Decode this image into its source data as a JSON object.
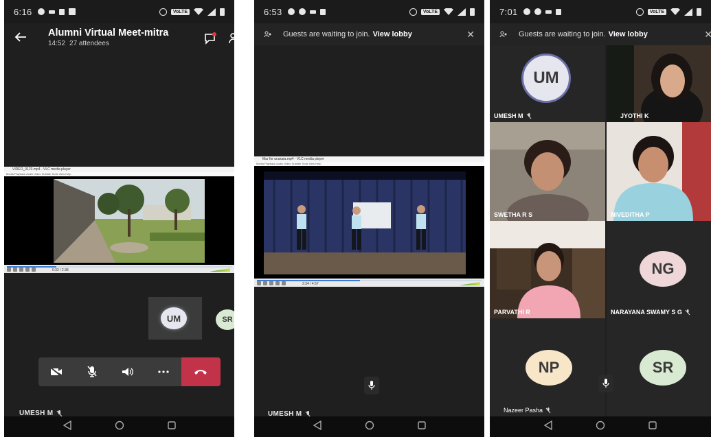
{
  "screens": [
    {
      "status": {
        "time": "6:16",
        "volte": "VoLTE"
      },
      "header": {
        "title": "Alumni Virtual Meet-mitra",
        "duration": "14:52",
        "attendees": "27 attendees"
      },
      "vlc": {
        "title": "VIDEO_0123.mp4 - VLC media player",
        "menu": "Media  Playback  Audio  Video  Subtitle  Tools  View  Help",
        "time": "0:32 / 2:38"
      },
      "avatars": [
        {
          "initials": "UM",
          "color": "#e6e6ee"
        },
        {
          "initials": "SR",
          "color": "#d9ead2"
        }
      ],
      "self_name": "UMESH M"
    },
    {
      "status": {
        "time": "6:53",
        "volte": "VoLTE"
      },
      "lobby": {
        "text": "Guests are waiting to join.",
        "link": "View lobby"
      },
      "vlc": {
        "title": "Mar for unarara.mp4 - VLC media player",
        "menu": "Media  Playback  Audio  Video  Subtitle  Tools  View  Help",
        "time": "2:34 / 4:57"
      },
      "self_name": "UMESH M"
    },
    {
      "status": {
        "time": "7:01",
        "volte": "VoLTE"
      },
      "lobby": {
        "text": "Guests are waiting to join.",
        "link": "View lobby"
      },
      "tiles": [
        {
          "name": "UMESH M",
          "initials": "UM",
          "color": "#e6e6ee"
        },
        {
          "name": "JYOTHI K"
        },
        {
          "name": "SWETHA R S"
        },
        {
          "name": "NIVEDITHA P"
        },
        {
          "name": "PARVATHI R"
        },
        {
          "name": "NARAYANA SWAMY S G",
          "initials": "NG",
          "color": "#efd6d8"
        },
        {
          "name": "Nazeer Pasha",
          "initials": "NP",
          "color": "#f7e6c8"
        },
        {
          "name": "",
          "initials": "SR",
          "color": "#d9ead2"
        }
      ]
    }
  ]
}
